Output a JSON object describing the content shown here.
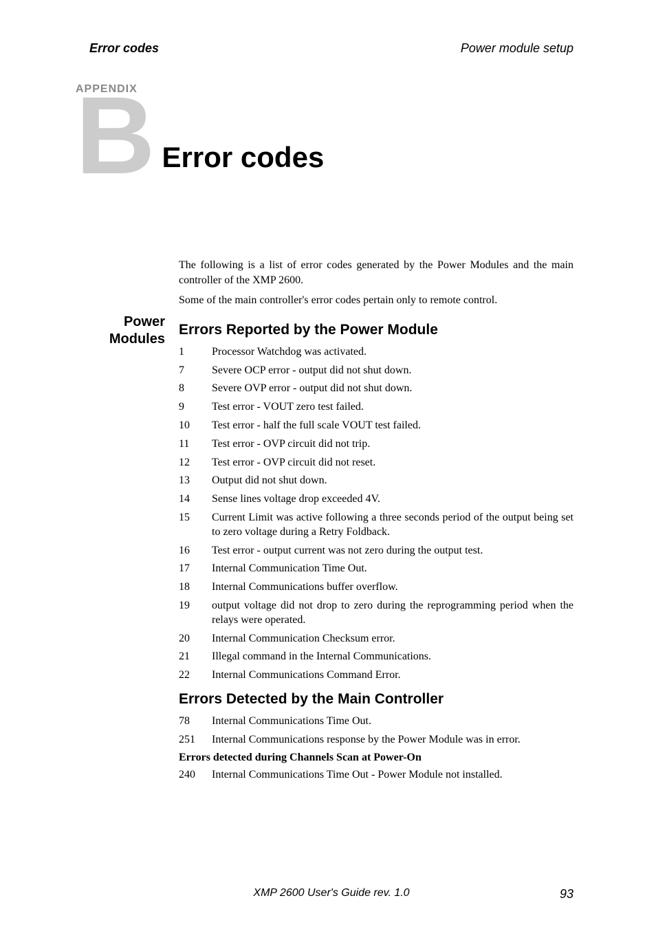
{
  "header": {
    "left": "Error codes",
    "right": "Power module setup"
  },
  "appendix": {
    "label": "APPENDIX",
    "letter": "B",
    "title": "Error codes"
  },
  "intro": {
    "p1": "The following is a list of error codes generated by the Power Modules and the main controller of the XMP 2600.",
    "p2": "Some of the main controller's error codes pertain only to remote control."
  },
  "sideHeading": "Power Modules",
  "section1": {
    "heading": "Errors Reported by the Power Module",
    "errors": [
      {
        "code": "1",
        "desc": "Processor Watchdog was activated."
      },
      {
        "code": "7",
        "desc": "Severe OCP error - output did not shut down."
      },
      {
        "code": "8",
        "desc": "Severe OVP error - output did not shut down."
      },
      {
        "code": "9",
        "desc": "Test error - VOUT zero test failed."
      },
      {
        "code": "10",
        "desc": "Test error - half the full scale VOUT test failed."
      },
      {
        "code": "11",
        "desc": "Test error - OVP circuit did not trip."
      },
      {
        "code": "12",
        "desc": "Test error - OVP circuit did not reset."
      },
      {
        "code": "13",
        "desc": "Output did not shut down."
      },
      {
        "code": "14",
        "desc": "Sense lines voltage drop exceeded 4V."
      },
      {
        "code": "15",
        "desc": "Current Limit was active following a three seconds period of the output being set to zero voltage during a Retry Foldback."
      },
      {
        "code": "16",
        "desc": "Test error - output current was not zero during the output test."
      },
      {
        "code": "17",
        "desc": "Internal Communication Time Out."
      },
      {
        "code": "18",
        "desc": "Internal Communications buffer overflow."
      },
      {
        "code": "19",
        "desc": "output voltage did not drop to zero during the reprogramming period when the relays were operated."
      },
      {
        "code": "20",
        "desc": "Internal Communication Checksum error."
      },
      {
        "code": "21",
        "desc": "Illegal command in the Internal Communications."
      },
      {
        "code": "22",
        "desc": "Internal Communications Command Error."
      }
    ]
  },
  "section2": {
    "heading": "Errors Detected by the Main Controller",
    "errors": [
      {
        "code": "78",
        "desc": "Internal Communications Time Out."
      },
      {
        "code": "251",
        "desc": "Internal Communications response by the Power Module was in error."
      }
    ],
    "subHeading": "Errors detected during Channels Scan at Power-On",
    "subErrors": [
      {
        "code": "240",
        "desc": "Internal Communications Time Out - Power Module not installed."
      }
    ]
  },
  "footer": {
    "center": "XMP 2600 User's Guide rev. 1.0",
    "pageNum": "93"
  }
}
